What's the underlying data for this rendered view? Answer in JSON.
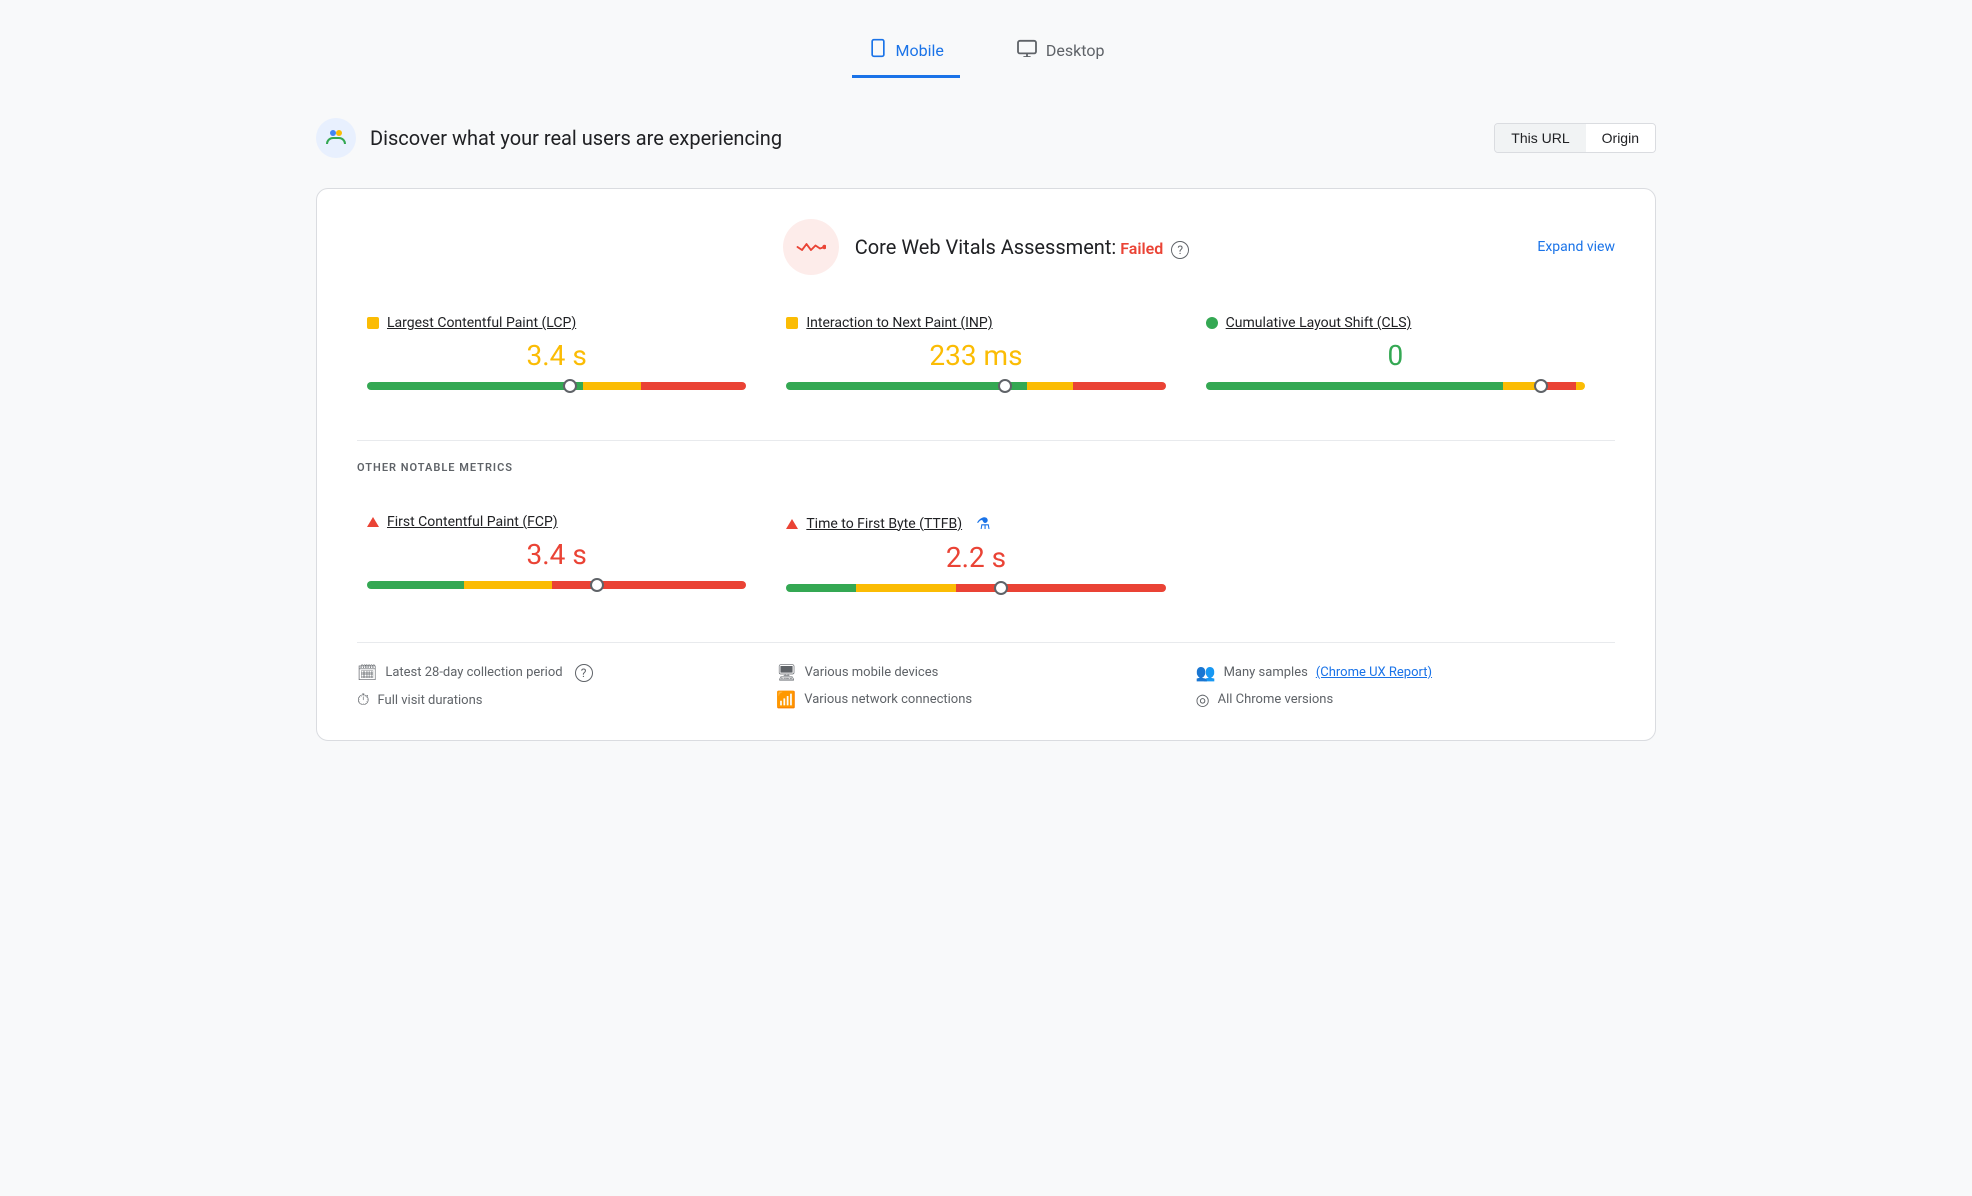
{
  "tabs": {
    "mobile": {
      "label": "Mobile",
      "active": true
    },
    "desktop": {
      "label": "Desktop",
      "active": false
    }
  },
  "header": {
    "title": "Discover what your real users are experiencing",
    "url_button": "This URL",
    "origin_button": "Origin"
  },
  "assessment": {
    "title": "Core Web Vitals Assessment:",
    "status": "Failed",
    "expand_label": "Expand view",
    "help_icon": "?"
  },
  "metrics": [
    {
      "name": "Largest Contentful Paint (LCP)",
      "value": "3.4 s",
      "color": "orange",
      "indicator_pct": 55,
      "bar": [
        45,
        10,
        20,
        25
      ]
    },
    {
      "name": "Interaction to Next Paint (INP)",
      "value": "233 ms",
      "color": "orange",
      "indicator_pct": 54,
      "bar": [
        50,
        8,
        18,
        24
      ]
    },
    {
      "name": "Cumulative Layout Shift (CLS)",
      "value": "0",
      "color": "green",
      "dot_type": "circle",
      "indicator_pct": 91,
      "bar": [
        60,
        8,
        18,
        5
      ]
    }
  ],
  "other_metrics_label": "OTHER NOTABLE METRICS",
  "other_metrics": [
    {
      "name": "First Contentful Paint (FCP)",
      "value": "3.4 s",
      "color": "red",
      "indicator_pct": 60,
      "bar": [
        18,
        15,
        40,
        27
      ]
    },
    {
      "name": "Time to First Byte (TTFB)",
      "value": "2.2 s",
      "color": "red",
      "indicator_pct": 58,
      "bar": [
        12,
        18,
        42,
        28
      ],
      "has_flask": true
    }
  ],
  "footer": {
    "col1": [
      {
        "icon": "📅",
        "text": "Latest 28-day collection period",
        "has_help": true
      },
      {
        "icon": "⏱",
        "text": "Full visit durations"
      }
    ],
    "col2": [
      {
        "icon": "📱",
        "text": "Various mobile devices"
      },
      {
        "icon": "📶",
        "text": "Various network connections"
      }
    ],
    "col3": [
      {
        "icon": "👥",
        "text": "Many samples",
        "link": "Chrome UX Report"
      },
      {
        "icon": "⊙",
        "text": "All Chrome versions"
      }
    ]
  }
}
